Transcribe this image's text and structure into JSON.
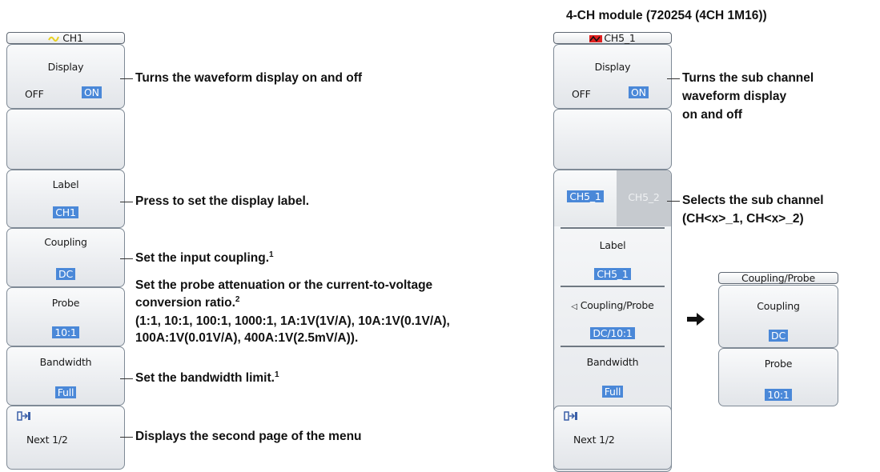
{
  "left": {
    "header": "CH1",
    "display": {
      "label": "Display",
      "off": "OFF",
      "on": "ON"
    },
    "label_key": {
      "label": "Label",
      "value": "CH1"
    },
    "coupling": {
      "label": "Coupling",
      "value": "DC"
    },
    "probe": {
      "label": "Probe",
      "value": "10:1"
    },
    "bandwidth": {
      "label": "Bandwidth",
      "value": "Full"
    },
    "next": {
      "icon": "page-turn-icon",
      "label": "Next 1/2"
    }
  },
  "annotations": {
    "display": "Turns the waveform display on and off",
    "label": "Press to set the display label.",
    "coupling": "Set the input coupling.",
    "coupling_sup": "1",
    "probe_line1": "Set the probe attenuation or the current-to-voltage",
    "probe_line2": "conversion ratio.",
    "probe_sup": "2",
    "probe_line3": "(1:1, 10:1, 100:1, 1000:1, 1A:1V(1V/A), 10A:1V(0.1V/A),",
    "probe_line4": "100A:1V(0.01V/A), 400A:1V(2.5mV/A)).",
    "bandwidth": "Set the bandwidth limit.",
    "bandwidth_sup": "1",
    "next": "Displays the second page of the menu"
  },
  "right": {
    "module_title": "4-CH module (720254 (4CH 1M16))",
    "header": "CH5_1",
    "display": {
      "label": "Display",
      "off": "OFF",
      "on": "ON"
    },
    "subch": {
      "tab1": "CH5_1",
      "tab2": "CH5_2"
    },
    "label_key": {
      "label": "Label",
      "value": "CH5_1"
    },
    "coupling_probe": {
      "label": "Coupling/Probe",
      "value": "DC/10:1"
    },
    "bandwidth": {
      "label": "Bandwidth",
      "value": "Full"
    },
    "next": {
      "icon": "page-turn-icon",
      "label": "Next 1/2"
    },
    "ann_display_1": "Turns the sub channel",
    "ann_display_2": "waveform display",
    "ann_display_3": "on and off",
    "ann_subch_1": "Selects the sub channel",
    "ann_subch_2": "(CH<x>_1, CH<x>_2)"
  },
  "submenu": {
    "header": "Coupling/Probe",
    "coupling": {
      "label": "Coupling",
      "value": "DC"
    },
    "probe": {
      "label": "Probe",
      "value": "10:1"
    }
  },
  "colors": {
    "selection": "#4a88d8",
    "waveform_icon_red": "#e02020",
    "waveform_icon_yellow": "#e8d020"
  }
}
